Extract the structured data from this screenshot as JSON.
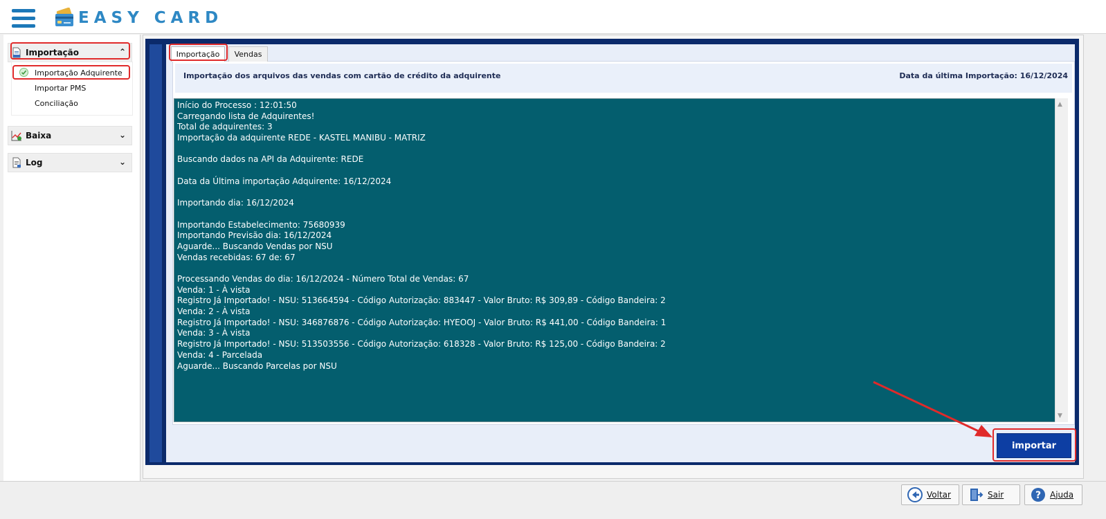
{
  "header": {
    "app_title": "EASY CARD",
    "menu_icon": "hamburger-icon",
    "logo_icon": "credit-card-logo-icon"
  },
  "sidebar": {
    "groups": [
      {
        "label": "Importação",
        "icon": "document-import-icon",
        "chevron": "double-chevron-up-icon",
        "expanded": true
      },
      {
        "label": "Baixa",
        "icon": "chart-line-icon",
        "chevron": "double-chevron-down-icon",
        "expanded": false
      },
      {
        "label": "Log",
        "icon": "document-log-icon",
        "chevron": "double-chevron-down-icon",
        "expanded": false
      }
    ],
    "import_items": [
      {
        "label": "Importação Adquirente",
        "selected": true,
        "icon": "check-circle-icon"
      },
      {
        "label": "Importar PMS",
        "selected": false
      },
      {
        "label": "Conciliação",
        "selected": false
      }
    ]
  },
  "tabs": [
    {
      "label": "Importação",
      "active": true
    },
    {
      "label": "Vendas",
      "active": false
    }
  ],
  "info_bar": {
    "description": "Importação dos arquivos das vendas com cartão de crédito da adquirente",
    "last_import": "Data da última Importação: 16/12/2024"
  },
  "log": {
    "lines": [
      "Início do Processo : 12:01:50",
      "Carregando lista de Adquirentes!",
      "Total de adquirentes: 3",
      "Importação da adquirente REDE - KASTEL MANIBU - MATRIZ",
      "",
      "Buscando dados na API da Adquirente: REDE",
      "",
      "Data da Última importação Adquirente: 16/12/2024",
      "",
      "Importando dia: 16/12/2024",
      "",
      "Importando Estabelecimento: 75680939",
      "Importando Previsão dia: 16/12/2024",
      "Aguarde... Buscando Vendas por NSU",
      "Vendas recebidas: 67 de: 67",
      "",
      "Processando Vendas do dia: 16/12/2024 - Número Total de Vendas: 67",
      "Venda: 1 - À vista",
      "Registro Já Importado! - NSU: 513664594 - Código Autorização: 883447 - Valor Bruto: R$ 309,89 - Código Bandeira: 2",
      "Venda: 2 - À vista",
      "Registro Já Importado! - NSU: 346876876 - Código Autorização: HYEOOJ - Valor Bruto: R$ 441,00 - Código Bandeira: 1",
      "Venda: 3 - À vista",
      "Registro Já Importado! - NSU: 513503556 - Código Autorização: 618328 - Valor Bruto: R$ 125,00 - Código Bandeira: 2",
      "Venda: 4 - Parcelada",
      "Aguarde... Buscando Parcelas por NSU"
    ]
  },
  "actions": {
    "import_label": "importar"
  },
  "footer": {
    "back_label": "Voltar",
    "exit_label": "Sair",
    "help_label": "Ajuda"
  },
  "colors": {
    "log_background": "#045e6e",
    "frame_navy": "#0b2a6b",
    "button_blue": "#0d3ea3",
    "highlight_red": "#e02a2a"
  }
}
